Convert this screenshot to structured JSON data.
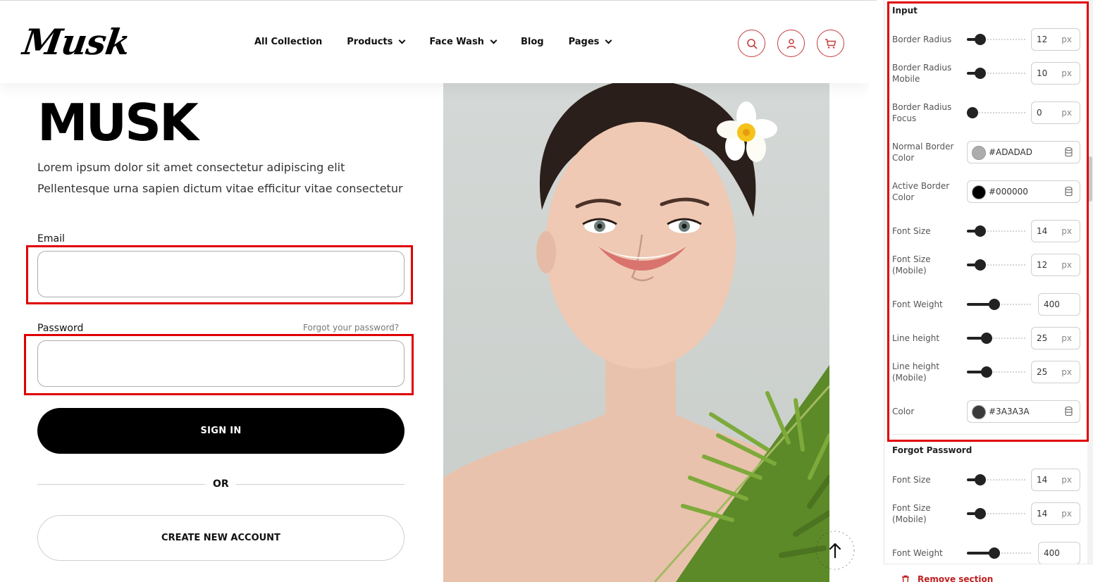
{
  "header": {
    "logo": "Musk",
    "nav": [
      {
        "label": "All Collection",
        "has_dropdown": false
      },
      {
        "label": "Products",
        "has_dropdown": true
      },
      {
        "label": "Face Wash",
        "has_dropdown": true
      },
      {
        "label": "Blog",
        "has_dropdown": false
      },
      {
        "label": "Pages",
        "has_dropdown": true
      }
    ],
    "icons": [
      "search-icon",
      "user-icon",
      "cart-icon"
    ],
    "icon_color": "#c63b3b"
  },
  "hero": {
    "title": "MUSK",
    "line1": "Lorem ipsum dolor sit amet consectetur adipiscing elit",
    "line2": "Pellentesque urna sapien dictum vitae efficitur vitae consectetur"
  },
  "form": {
    "email_label": "Email",
    "email_value": "",
    "password_label": "Password",
    "password_value": "",
    "forgot_link": "Forgot your password?",
    "signin_button": "SIGN IN",
    "or_text": "OR",
    "create_button": "CREATE NEW ACCOUNT"
  },
  "scroll_top": {
    "label": "SCROLL TO TOP"
  },
  "settings": {
    "input_section_title": "Input",
    "input_rows": [
      {
        "label": "Border Radius",
        "value": "12",
        "unit": "px",
        "level": 0.16
      },
      {
        "label": "Border Radius Mobile",
        "value": "10",
        "unit": "px",
        "level": 0.16
      },
      {
        "label": "Border Radius Focus",
        "value": "0",
        "unit": "px",
        "level": 0.0
      },
      {
        "label": "Normal Border Color",
        "color": "#ADADAD"
      },
      {
        "label": "Active Border Color",
        "color": "#000000"
      },
      {
        "label": "Font Size",
        "value": "14",
        "unit": "px",
        "level": 0.16
      },
      {
        "label": "Font Size (Mobile)",
        "value": "12",
        "unit": "px",
        "level": 0.16
      },
      {
        "label": "Font Weight",
        "value": "400",
        "unit": "",
        "level": 0.4
      },
      {
        "label": "Line height",
        "value": "25",
        "unit": "px",
        "level": 0.3
      },
      {
        "label": "Line height (Mobile)",
        "value": "25",
        "unit": "px",
        "level": 0.3
      },
      {
        "label": "Color",
        "color": "#3A3A3A"
      }
    ],
    "forgot_section_title": "Forgot Password",
    "forgot_rows": [
      {
        "label": "Font Size",
        "value": "14",
        "unit": "px",
        "level": 0.16
      },
      {
        "label": "Font Size (Mobile)",
        "value": "14",
        "unit": "px",
        "level": 0.16
      },
      {
        "label": "Font Weight",
        "value": "400",
        "unit": "",
        "level": 0.4
      }
    ],
    "remove_section": "Remove section"
  },
  "colors": {
    "highlight": "#e00000",
    "accent_scroll": "#c6b493"
  }
}
